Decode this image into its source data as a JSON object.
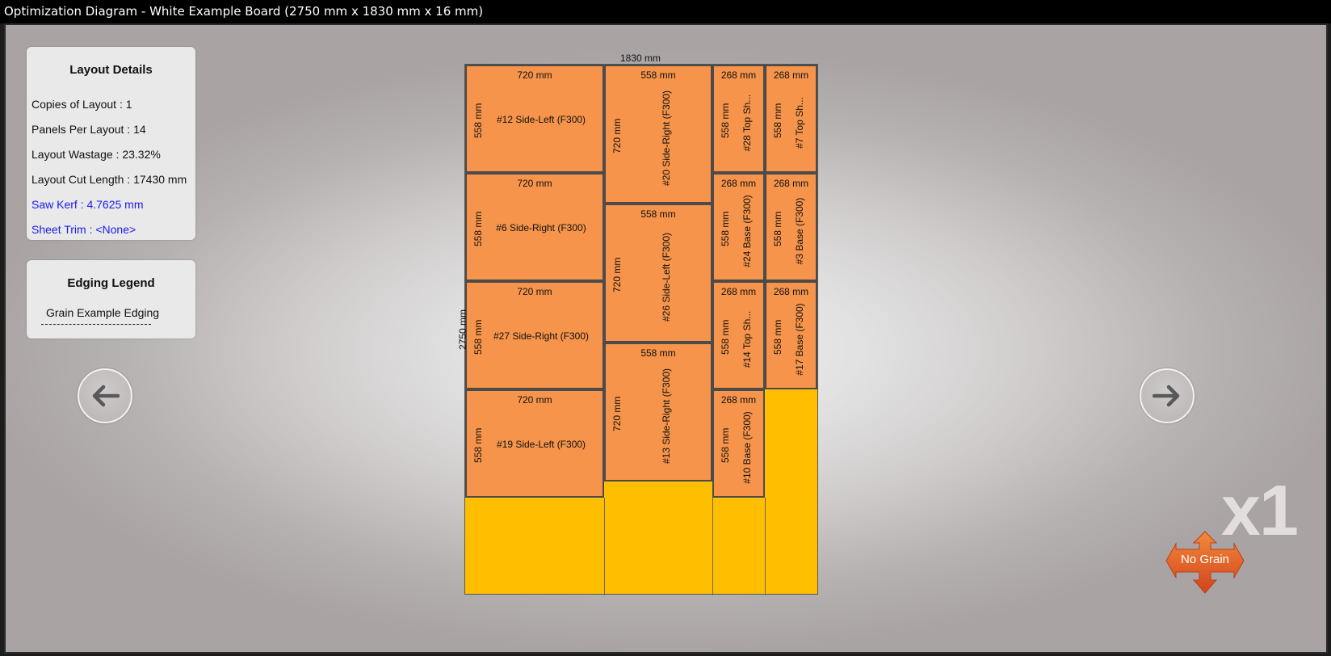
{
  "window": {
    "title": "Optimization Diagram - White Example Board (2750 mm x 1830 mm x 16 mm)"
  },
  "layout_details": {
    "title": "Layout Details",
    "copies": "Copies of Layout :  1",
    "panels": "Panels Per Layout :  14",
    "wastage": "Layout Wastage :  23.32%",
    "cut_length": "Layout Cut Length :  17430 mm",
    "saw_kerf": "Saw Kerf :  4.7625 mm",
    "sheet_trim": "Sheet Trim :  <None>"
  },
  "edging_legend": {
    "title": "Edging Legend",
    "item": "Grain Example Edging"
  },
  "nav": {
    "prev_icon": "arrow-left-icon",
    "next_icon": "arrow-right-icon"
  },
  "multiplier": "x1",
  "grain_button": "No Grain",
  "colors": {
    "piece": "#f5944a",
    "waste": "#ffbe00",
    "link": "#1a1af0"
  },
  "board": {
    "width_label": "1830 mm",
    "height_label": "2750 mm",
    "pieces": [
      {
        "w": "720 mm",
        "h": "558 mm",
        "name": "#12 Side-Left (F300)"
      },
      {
        "w": "720 mm",
        "h": "558 mm",
        "name": "#6 Side-Right (F300)"
      },
      {
        "w": "720 mm",
        "h": "558 mm",
        "name": "#27 Side-Right (F300)"
      },
      {
        "w": "720 mm",
        "h": "558 mm",
        "name": "#19 Side-Left (F300)"
      },
      {
        "w": "558 mm",
        "h": "720 mm",
        "name": "#20 Side-Right (F300)"
      },
      {
        "w": "558 mm",
        "h": "720 mm",
        "name": "#26 Side-Left (F300)"
      },
      {
        "w": "558 mm",
        "h": "720 mm",
        "name": "#13 Side-Right (F300)"
      },
      {
        "w": "268 mm",
        "h": "558 mm",
        "name": "#28 Top Sh..."
      },
      {
        "w": "268 mm",
        "h": "558 mm",
        "name": "#24 Base (F300)"
      },
      {
        "w": "268 mm",
        "h": "558 mm",
        "name": "#14 Top Sh..."
      },
      {
        "w": "268 mm",
        "h": "558 mm",
        "name": "#10 Base (F300)"
      },
      {
        "w": "268 mm",
        "h": "558 mm",
        "name": "#7 Top Sh..."
      },
      {
        "w": "268 mm",
        "h": "558 mm",
        "name": "#3 Base (F300)"
      },
      {
        "w": "268 mm",
        "h": "558 mm",
        "name": "#17 Base (F300)"
      }
    ]
  }
}
